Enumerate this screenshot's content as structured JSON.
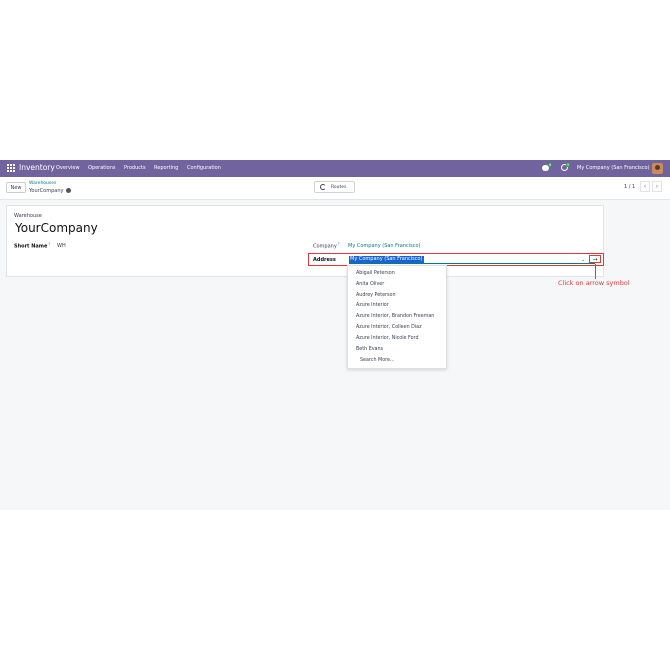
{
  "navbar": {
    "brand": "Inventory",
    "menu": [
      "Overview",
      "Operations",
      "Products",
      "Reporting",
      "Configuration"
    ],
    "chat_badge": "6",
    "activity_badge": "9",
    "company": "My Company (San Francisco)"
  },
  "control_panel": {
    "new_label": "New",
    "breadcrumb_parent": "Warehouses",
    "breadcrumb_current": "YourCompany",
    "routes_label": "Routes",
    "pager": "1 / 1"
  },
  "form": {
    "warehouse_label": "Warehouse",
    "warehouse_name": "YourCompany",
    "short_name_label": "Short Name",
    "short_name_help": "?",
    "short_name_value": "WH",
    "company_label": "Company",
    "company_help": "?",
    "company_value": "My Company (San Francisco)",
    "address_label": "Address",
    "address_value": "My Company (San Francisco)"
  },
  "dropdown": {
    "items": [
      "Abigail Peterson",
      "Anita Oliver",
      "Audrey Peterson",
      "Azure Interior",
      "Azure Interior, Brandon Freeman",
      "Azure Interior, Colleen Diaz",
      "Azure Interior, Nicole Ford",
      "Beth Evans"
    ],
    "search_more": "Search More..."
  },
  "annotation": {
    "text": "Click on arrow symbol",
    "color": "#e53935"
  },
  "colors": {
    "navbar": "#71639e",
    "link": "#017e84",
    "highlight": "#e53935"
  }
}
